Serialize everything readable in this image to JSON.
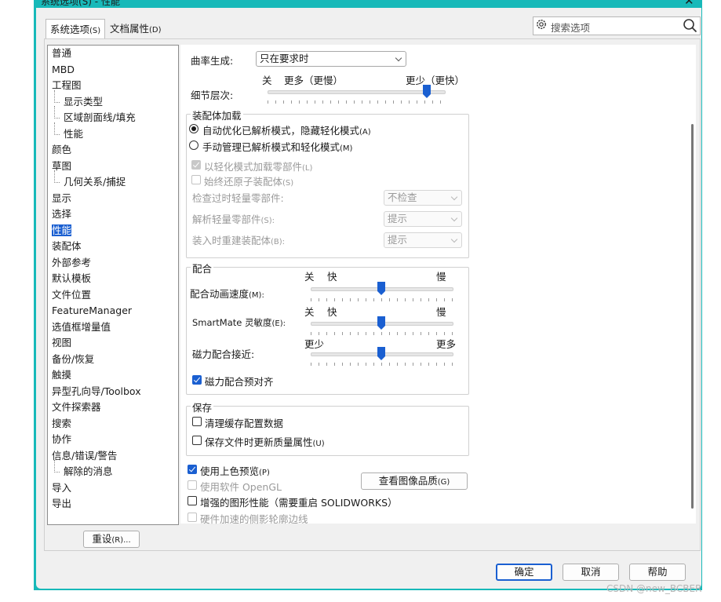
{
  "window": {
    "title": "系统选项(S) - 性能",
    "close_label": "✕"
  },
  "tabs": [
    {
      "label": "系统选项",
      "hotkey": "(S)"
    },
    {
      "label": "文档属性",
      "hotkey": "(D)"
    }
  ],
  "search": {
    "placeholder": "搜索选项"
  },
  "tree": {
    "items": [
      {
        "label": "普通",
        "sub": false
      },
      {
        "label": "MBD",
        "sub": false
      },
      {
        "label": "工程图",
        "sub": false
      },
      {
        "label": "显示类型",
        "sub": true
      },
      {
        "label": "区域剖面线/填充",
        "sub": true
      },
      {
        "label": "性能",
        "sub": true
      },
      {
        "label": "颜色",
        "sub": false
      },
      {
        "label": "草图",
        "sub": false
      },
      {
        "label": "几何关系/捕捉",
        "sub": true
      },
      {
        "label": "显示",
        "sub": false
      },
      {
        "label": "选择",
        "sub": false
      },
      {
        "label": "性能",
        "sub": false,
        "selected": true
      },
      {
        "label": "装配体",
        "sub": false
      },
      {
        "label": "外部参考",
        "sub": false
      },
      {
        "label": "默认模板",
        "sub": false
      },
      {
        "label": "文件位置",
        "sub": false
      },
      {
        "label": "FeatureManager",
        "sub": false
      },
      {
        "label": "选值框增量值",
        "sub": false
      },
      {
        "label": "视图",
        "sub": false
      },
      {
        "label": "备份/恢复",
        "sub": false
      },
      {
        "label": "触摸",
        "sub": false
      },
      {
        "label": "异型孔向导/Toolbox",
        "sub": false
      },
      {
        "label": "文件探索器",
        "sub": false
      },
      {
        "label": "搜索",
        "sub": false
      },
      {
        "label": "协作",
        "sub": false
      },
      {
        "label": "信息/错误/警告",
        "sub": false
      },
      {
        "label": "解除的消息",
        "sub": true
      },
      {
        "label": "导入",
        "sub": false
      },
      {
        "label": "导出",
        "sub": false
      }
    ]
  },
  "reset_button": {
    "label": "重设",
    "hotkey": "(R)..."
  },
  "curvature": {
    "label": "曲率生成:",
    "value": "只在要求时"
  },
  "detail": {
    "label": "细节层次:",
    "left_words": "关",
    "more_slow": "更多（更慢）",
    "less_fast": "更少（更快）",
    "level": 0.9
  },
  "assembly_load": {
    "title": "装配体加载",
    "radio_auto": {
      "label": "自动优化已解析模式，隐藏轻化模式",
      "hotkey": "(A)",
      "checked": true
    },
    "radio_manual": {
      "label": "手动管理已解析模式和轻化模式",
      "hotkey": "(M)",
      "checked": false
    },
    "cb_lightweight": {
      "label": "以轻化模式加载零部件",
      "hotkey": "(L)",
      "checked": true,
      "disabled": true
    },
    "cb_restore": {
      "label": "始终还原子装配体",
      "hotkey": "(S)",
      "checked": false,
      "disabled": true
    },
    "check_outdated": {
      "label": "检查过时轻量零部件:",
      "value": "不检查"
    },
    "resolve": {
      "label": "解析轻量零部件",
      "hotkey": "(S):",
      "value": "提示"
    },
    "rebuild": {
      "label": "装入时重建装配体",
      "hotkey": "(B):",
      "value": "提示"
    }
  },
  "mate": {
    "title": "配合",
    "anim": {
      "label": "配合动画速度",
      "hotkey": "(M):",
      "off": "关",
      "fast": "快",
      "slow": "慢",
      "level": 0.5
    },
    "smartmate": {
      "label": "SmartMate 灵敏度",
      "hotkey": "(E):",
      "off": "关",
      "fast": "快",
      "slow": "慢",
      "level": 0.5
    },
    "magnetic": {
      "label": "磁力配合接近:",
      "less": "更少",
      "more": "更多",
      "level": 0.5
    },
    "cb_prealign": {
      "label": "磁力配合预对齐",
      "checked": true
    }
  },
  "save": {
    "title": "保存",
    "cb_purge": {
      "label": "清理缓存配置数据",
      "checked": false
    },
    "cb_update": {
      "label": "保存文件时更新质量属性",
      "hotkey": "(U)",
      "checked": false
    }
  },
  "bottom": {
    "cb_shaded": {
      "label": "使用上色预览",
      "hotkey": "(P)",
      "checked": true
    },
    "cb_opengl": {
      "label": "使用软件 OpenGL",
      "checked": false,
      "disabled": true
    },
    "cb_enhanced": {
      "label": "增强的图形性能（需要重启 SOLIDWORKS）",
      "checked": false
    },
    "cb_hw": {
      "label": "硬件加速的侧影轮廓边线",
      "checked": false,
      "disabled": true
    },
    "image_quality_button": {
      "label": "查看图像品质",
      "hotkey": "(G)"
    }
  },
  "footer": {
    "ok": "确定",
    "cancel": "取消",
    "help": "帮助"
  },
  "watermark": "CSDN @new_BCBER",
  "colors": {
    "accent": "#1a5fd1",
    "frame": "#17b9b9"
  }
}
